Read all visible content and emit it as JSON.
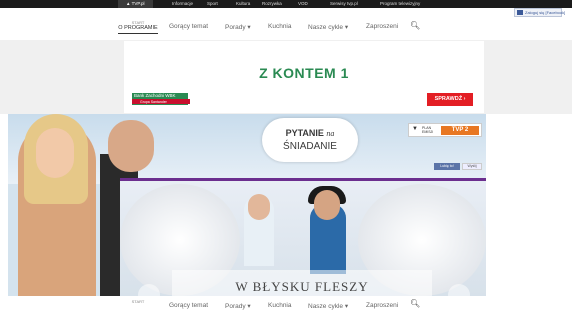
{
  "topbar": {
    "items": [
      "▲ TVP.pl",
      "Informacje",
      "Sport",
      "Kultura",
      "Rozrywka",
      "VOD",
      "Serwisy tvp.pl",
      "Program telewizyjny"
    ]
  },
  "facebook_badge": "Zaloguj się [Facebook]",
  "nav": {
    "start": "START",
    "brand": "O PROGRAMIE",
    "links": [
      "Gorący temat",
      "Porady ▾",
      "Kuchnia",
      "Nasze cykle ▾",
      "Zaproszeni"
    ]
  },
  "ad": {
    "headline": "Z KONTEM 1",
    "bank_name": "Bank Zachodni WBK",
    "bank_sub": "Grupa Santander",
    "cta": "SPRAWDŹ ›"
  },
  "hero": {
    "title_line1": "PYTANIE",
    "title_na": "na",
    "title_line2": "ŚNIADANIE",
    "plan_label": "PLAN EMISJI",
    "channel": "TVP 2",
    "fb_like": "Lubię to!",
    "tweet": "Wyślij",
    "caption": "W BŁYSKU FLESZY"
  },
  "nav2": {
    "start": "START",
    "links": [
      "Gorący temat",
      "Porady ▾",
      "Kuchnia",
      "Nasze cykle ▾",
      "Zaproszeni"
    ]
  },
  "colors": {
    "topbar": "#1b1b1b",
    "ad_green": "#2a8a52",
    "cta_red": "#e31e24",
    "accent_purple": "#6b2e8e",
    "tvp_orange": "#e87722"
  }
}
